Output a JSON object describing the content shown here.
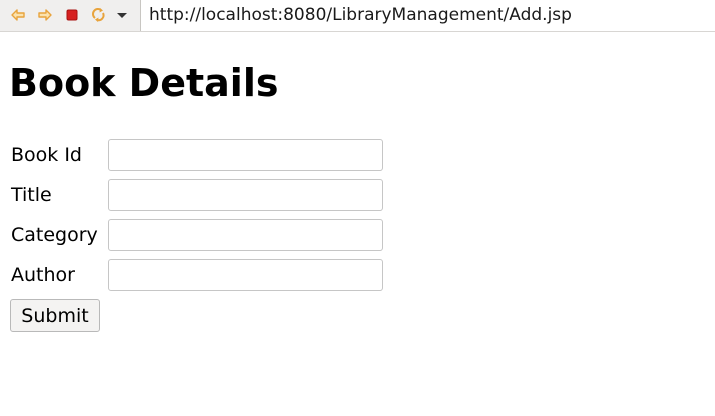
{
  "browser": {
    "url": "http://localhost:8080/LibraryManagement/Add.jsp",
    "icons": {
      "back": "back-arrow-icon",
      "forward": "forward-arrow-icon",
      "stop": "stop-icon",
      "refresh": "refresh-icon",
      "menu": "dropdown-arrow-icon"
    },
    "colors": {
      "nav_arrow": "#e8a33c",
      "stop": "#d62020",
      "toolbar_bg": "#f0efee"
    }
  },
  "page": {
    "title": "Book Details",
    "form": {
      "fields": [
        {
          "label": "Book Id",
          "value": ""
        },
        {
          "label": "Title",
          "value": ""
        },
        {
          "label": "Category",
          "value": ""
        },
        {
          "label": "Author",
          "value": ""
        }
      ],
      "submit_label": "Submit"
    }
  }
}
